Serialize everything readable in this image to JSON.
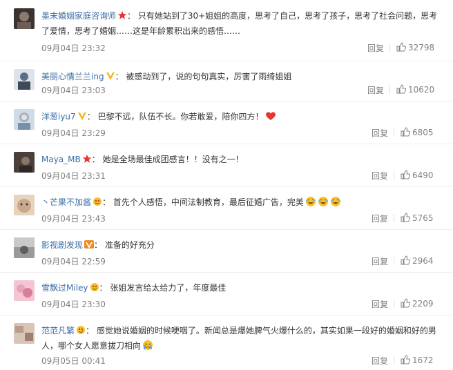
{
  "comments": [
    {
      "user": "墨末婚姻家庭咨询师",
      "badge": "star-badge",
      "text": "只有她站到了30+姐姐的高度，思考了自己，思考了孩子，思考了社会问题，思考了爱情，思考了婚姻……这是年龄累积出来的感悟……",
      "time": "09月04日 23:32",
      "reply": "回复",
      "likes": "32798",
      "avatar_color": "#3a3330"
    },
    {
      "user": "美丽心情兰兰ing",
      "badge": "v-badge",
      "text": "被感动到了，说的句句真实，厉害了雨绮姐姐",
      "time": "09月04日 23:03",
      "reply": "回复",
      "likes": "10620",
      "avatar_color": "#5d6f86"
    },
    {
      "user": "洋葱iyu7",
      "badge": "v-badge",
      "text": "巴黎不远，队伍不长。你若敢爱，陪你四方！",
      "emoji": "heart-emoji",
      "time": "09月04日 23:29",
      "reply": "回复",
      "likes": "6805",
      "avatar_color": "#9fb3c9"
    },
    {
      "user": "Maya_MB",
      "badge": "star-badge",
      "text": "她是全场最佳成团感言！！没有之一！",
      "time": "09月04日 23:31",
      "reply": "回复",
      "likes": "6490",
      "avatar_color": "#4a3f3a"
    },
    {
      "user": "丶芒果不加酱",
      "badge": "fan-badge",
      "text": "首先个人感悟，中间法制教育，最后征婚广告，完美",
      "emoji": "laugh-emoji",
      "time": "09月04日 23:43",
      "reply": "回复",
      "likes": "5765",
      "avatar_color": "#c9a98a"
    },
    {
      "user": "影视剧发现",
      "badge": "vip-badge",
      "text": "准备的好充分",
      "time": "09月04日 22:59",
      "reply": "回复",
      "likes": "2964",
      "avatar_color": "#7c7c7c"
    },
    {
      "user": "雪飘过Miley",
      "badge": "fan-badge",
      "text": "张姐发言给太给力了，年度最佳",
      "time": "09月04日 23:30",
      "reply": "回复",
      "likes": "2209",
      "avatar_color": "#e8a3b8"
    },
    {
      "user": "范范凡繁",
      "badge": "fan-badge",
      "text": "感觉她说婚姻的时候哽咽了。新闻总是爆她脾气火爆什么的，其实如果一段好的婚姻和好的男人，哪个女人愿意拔刀相向",
      "emoji": "cry-emoji",
      "time": "09月05日 00:41",
      "reply": "回复",
      "likes": "1672",
      "avatar_color": "#b99c8c"
    }
  ],
  "colors": {
    "username": "#3b6ea5",
    "meta": "#808080",
    "text": "#333333"
  }
}
